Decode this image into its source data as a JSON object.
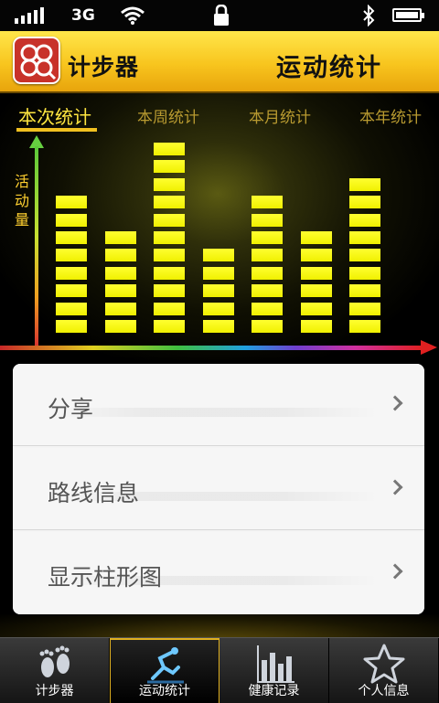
{
  "status_bar": {
    "network": "3G"
  },
  "header": {
    "app_name": "计步器",
    "page_title": "运动统计"
  },
  "stats_tabs": [
    {
      "label": "本次统计",
      "active": true
    },
    {
      "label": "本周统计",
      "active": false
    },
    {
      "label": "本月统计",
      "active": false
    },
    {
      "label": "本年统计",
      "active": false
    }
  ],
  "chart_data": {
    "type": "bar",
    "ylabel": "活动量",
    "xlabel": "",
    "values": [
      8,
      6,
      11,
      5,
      8,
      6,
      9
    ],
    "units": "segments"
  },
  "menu": {
    "items": [
      {
        "label": "分享"
      },
      {
        "label": "路线信息"
      },
      {
        "label": "显示柱形图"
      }
    ]
  },
  "tabbar": {
    "items": [
      {
        "label": "计步器",
        "icon": "footprints-icon",
        "active": false
      },
      {
        "label": "运动统计",
        "icon": "runner-icon",
        "active": true
      },
      {
        "label": "健康记录",
        "icon": "bar-chart-icon",
        "active": false
      },
      {
        "label": "个人信息",
        "icon": "star-icon",
        "active": false
      }
    ]
  },
  "colors": {
    "accent": "#f8c51e",
    "bar": "#ffff20",
    "active_tab_text": "#ffe640"
  }
}
